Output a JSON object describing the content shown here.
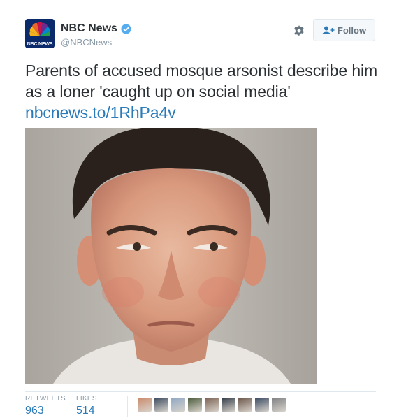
{
  "account": {
    "display_name": "NBC News",
    "handle": "@NBCNews",
    "verified": true,
    "avatar_text": "NBC NEWS",
    "avatar_icon": "nbc-peacock-logo"
  },
  "actions": {
    "settings_icon": "gear-icon",
    "follow_label": "Follow",
    "follow_icon": "add-user-icon"
  },
  "tweet": {
    "text": "Parents of accused mosque arsonist describe him as a loner 'caught up on social media' ",
    "link_text": "nbcnews.to/1RhPa4v"
  },
  "media": {
    "type": "photo",
    "subject": "mugshot"
  },
  "stats": {
    "retweets_label": "RETWEETS",
    "retweets_value": "963",
    "likes_label": "LIKES",
    "likes_value": "514"
  },
  "likers": [
    {
      "color": "#c98a6a"
    },
    {
      "color": "#3b4a5e"
    },
    {
      "color": "#8fa7c2"
    },
    {
      "color": "#4a5a3a"
    },
    {
      "color": "#7a6050"
    },
    {
      "color": "#2f3a45"
    },
    {
      "color": "#6a5548"
    },
    {
      "color": "#384860"
    },
    {
      "color": "#7d7f82"
    }
  ],
  "colors": {
    "link": "#2b7bb9",
    "muted": "#8899a6",
    "text": "#292f33",
    "verified": "#55acee"
  }
}
